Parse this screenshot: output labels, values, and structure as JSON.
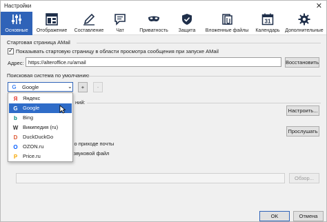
{
  "window": {
    "title": "Настройки",
    "close": "✕"
  },
  "toolbar": {
    "items": [
      {
        "label": "Основные",
        "icon": "sliders-icon",
        "active": true
      },
      {
        "label": "Отображение",
        "icon": "layout-grid-icon"
      },
      {
        "label": "Составление",
        "icon": "pen-icon"
      },
      {
        "label": "Чат",
        "icon": "chat-bubble-icon"
      },
      {
        "label": "Приватность",
        "icon": "mask-icon"
      },
      {
        "label": "Защита",
        "icon": "shield-check-icon"
      },
      {
        "label": "Вложенные файлы",
        "icon": "paperclip-files-icon"
      },
      {
        "label": "Календарь",
        "icon": "calendar-icon",
        "calendar_day": "31"
      },
      {
        "label": "Дополнительные",
        "icon": "gear-icon"
      }
    ]
  },
  "start_page": {
    "header": "Стартовая страница AMail",
    "show_checkbox_label": "Показывать стартовую страницу в области просмотра сообщения при запуске AMail",
    "show_checked": true,
    "address_label": "Адрес:",
    "address_value": "https://alteroffice.ru/amail",
    "restore_button": "Восстановить"
  },
  "search": {
    "header": "Поисковая система по умолчанию",
    "selected": "Google",
    "add_button": "+",
    "remove_button": "-",
    "options": [
      {
        "label": "Яндекс",
        "icon": "yandex-icon",
        "glyph": "Я",
        "color": "#e63327"
      },
      {
        "label": "Google",
        "icon": "google-icon",
        "glyph": "G",
        "color": "#4285f4"
      },
      {
        "label": "Bing",
        "icon": "bing-icon",
        "glyph": "b",
        "color": "#00897b"
      },
      {
        "label": "Википедия (ru)",
        "icon": "wikipedia-icon",
        "glyph": "W",
        "color": "#333333"
      },
      {
        "label": "DuckDuckGo",
        "icon": "duckduckgo-icon",
        "glyph": "D",
        "color": "#de5833"
      },
      {
        "label": "OZON.ru",
        "icon": "ozon-icon",
        "glyph": "O",
        "color": "#005bff"
      },
      {
        "label": "Price.ru",
        "icon": "price-icon",
        "glyph": "P",
        "color": "#f7a600"
      }
    ],
    "highlighted_index": 1
  },
  "behind_dropdown": {
    "fragment_line1": "ний:",
    "setup_button": "Настроить...",
    "listen_button": "Прослушать",
    "fragment_line2": "гнал о приходе почты",
    "fragment_line3": "щий звуковой файл",
    "browse_button": "Обзор..."
  },
  "footer": {
    "ok": "OK",
    "cancel": "Отмена"
  },
  "colors": {
    "accent": "#2f63b8",
    "selection": "#2f6cc8"
  }
}
